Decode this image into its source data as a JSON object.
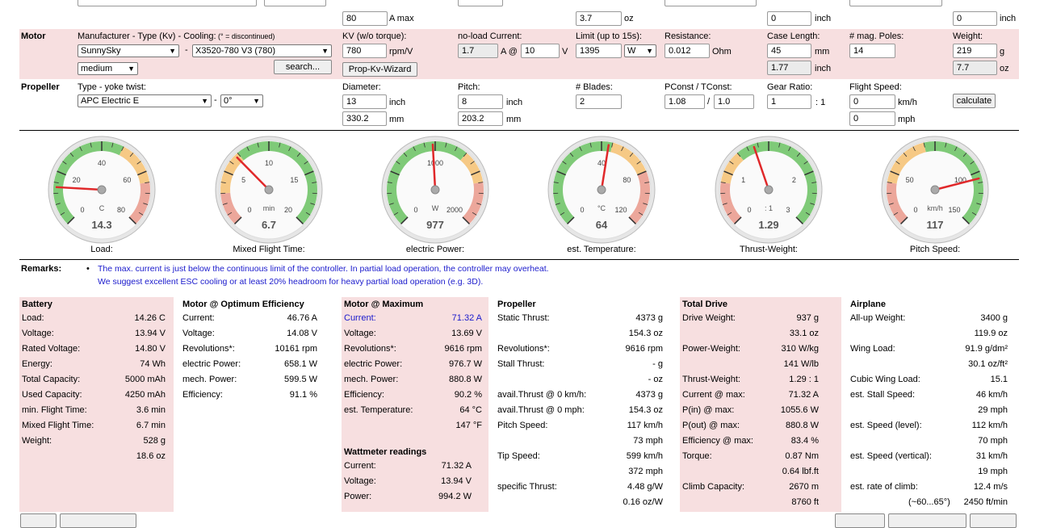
{
  "top_partial": {
    "amax_value": "80",
    "amax_unit": "A max",
    "oz_value": "3.7",
    "oz_unit": "oz",
    "inch1_value": "0",
    "inch1_unit": "inch",
    "inch2_value": "0",
    "inch2_unit": "inch"
  },
  "motor": {
    "section": "Motor",
    "mfr_label": "Manufacturer - Type (Kv) - Cooling:",
    "mfr_note": "(° = discontinued)",
    "manufacturer": "SunnySky",
    "dash": "-",
    "type": "X3520-780 V3 (780)",
    "cooling": "medium",
    "search_label": "search...",
    "kv_label": "KV (w/o torque):",
    "kv_value": "780",
    "kv_unit": "rpm/V",
    "propkv_label": "Prop-Kv-Wizard",
    "noload_label": "no-load Current:",
    "noload_a": "1.7",
    "noload_a_unit": "A @",
    "noload_v": "10",
    "noload_v_unit": "V",
    "limit_label": "Limit (up to 15s):",
    "limit_value": "1395",
    "limit_unit": "W",
    "res_label": "Resistance:",
    "res_value": "0.012",
    "res_unit": "Ohm",
    "case_label": "Case Length:",
    "case_mm": "45",
    "case_mm_unit": "mm",
    "case_inch": "1.77",
    "case_inch_unit": "inch",
    "poles_label": "# mag. Poles:",
    "poles_value": "14",
    "weight_label": "Weight:",
    "weight_g": "219",
    "weight_g_unit": "g",
    "weight_oz": "7.7",
    "weight_oz_unit": "oz"
  },
  "propeller_input": {
    "section": "Propeller",
    "type_label": "Type - yoke twist:",
    "type": "APC Electric E",
    "dash": "-",
    "twist": "0°",
    "dia_label": "Diameter:",
    "dia_inch": "13",
    "dia_inch_unit": "inch",
    "dia_mm": "330.2",
    "dia_mm_unit": "mm",
    "pitch_label": "Pitch:",
    "pitch_inch": "8",
    "pitch_inch_unit": "inch",
    "pitch_mm": "203.2",
    "pitch_mm_unit": "mm",
    "blades_label": "# Blades:",
    "blades_value": "2",
    "pconst_label": "PConst / TConst:",
    "pconst": "1.08",
    "slash": "/",
    "tconst": "1.0",
    "gear_label": "Gear Ratio:",
    "gear_value": "1",
    "gear_unit": ": 1",
    "speed_label": "Flight Speed:",
    "speed_kmh": "0",
    "speed_kmh_unit": "km/h",
    "speed_mph": "0",
    "speed_mph_unit": "mph",
    "calc_label": "calculate"
  },
  "gauges": [
    {
      "caption": "Load:",
      "value": "14.3",
      "unit": "C",
      "ticks": [
        "0",
        "20",
        "40",
        "60",
        "80"
      ],
      "min": 0,
      "max": 80,
      "reading": 14.3,
      "green_to": 0.6,
      "yellow_to": 0.8
    },
    {
      "caption": "Mixed Flight Time:",
      "value": "6.7",
      "unit": "min",
      "ticks": [
        "0",
        "5",
        "10",
        "15",
        "20"
      ],
      "min": 0,
      "max": 20,
      "reading": 6.7,
      "red_to": 0.15,
      "yellow_to": 0.35,
      "reverse": true
    },
    {
      "caption": "electric Power:",
      "value": "977",
      "unit": "W",
      "ticks": [
        "0",
        "",
        "1000",
        "",
        "2000"
      ],
      "min": 0,
      "max": 2000,
      "reading": 977,
      "green_to": 0.65,
      "yellow_to": 0.8
    },
    {
      "caption": "est. Temperature:",
      "value": "64",
      "unit": "°C",
      "ticks": [
        "0",
        "",
        "40",
        "80",
        "120"
      ],
      "min": 0,
      "max": 120,
      "reading": 64,
      "green_to": 0.55,
      "yellow_to": 0.75
    },
    {
      "caption": "Thrust-Weight:",
      "value": "1.29",
      "unit": ": 1",
      "ticks": [
        "0",
        "1",
        "",
        "2",
        "3"
      ],
      "min": 0,
      "max": 3,
      "reading": 1.29,
      "red_to": 0.2,
      "yellow_to": 0.35,
      "reverse": true
    },
    {
      "caption": "Pitch Speed:",
      "value": "117",
      "unit": "km/h",
      "ticks": [
        "0",
        "50",
        "",
        "100",
        "150"
      ],
      "min": 0,
      "max": 150,
      "reading": 117,
      "red_to": 0.2,
      "yellow_to": 0.45,
      "reverse": true
    }
  ],
  "remarks": {
    "label": "Remarks:",
    "bullet": "•",
    "line1": "The max. current is just below the continuous limit of the controller. In partial load operation, the controller may overheat.",
    "line2": "We suggest excellent ESC cooling or at least 20% headroom for heavy partial load operation (e.g. 3D)."
  },
  "battery": {
    "title": "Battery",
    "rows": [
      [
        "Load:",
        "14.26 C"
      ],
      [
        "Voltage:",
        "13.94 V"
      ],
      [
        "Rated Voltage:",
        "14.80 V"
      ],
      [
        "Energy:",
        "74 Wh"
      ],
      [
        "Total Capacity:",
        "5000 mAh"
      ],
      [
        "Used Capacity:",
        "4250 mAh"
      ],
      [
        "min. Flight Time:",
        "3.6 min"
      ],
      [
        "Mixed Flight Time:",
        "6.7 min"
      ],
      [
        "Weight:",
        "528 g"
      ],
      [
        "",
        "18.6 oz"
      ]
    ]
  },
  "motor_opt": {
    "title": "Motor @ Optimum Efficiency",
    "rows": [
      [
        "Current:",
        "46.76 A"
      ],
      [
        "Voltage:",
        "14.08 V"
      ],
      [
        "Revolutions*:",
        "10161 rpm"
      ],
      [
        "electric Power:",
        "658.1 W"
      ],
      [
        "mech. Power:",
        "599.5 W"
      ],
      [
        "Efficiency:",
        "91.1 %"
      ]
    ]
  },
  "motor_max": {
    "title": "Motor @ Maximum",
    "rows": [
      [
        "Current:",
        "71.32 A"
      ],
      [
        "Voltage:",
        "13.69 V"
      ],
      [
        "Revolutions*:",
        "9616 rpm"
      ],
      [
        "electric Power:",
        "976.7 W"
      ],
      [
        "mech. Power:",
        "880.8 W"
      ],
      [
        "Efficiency:",
        "90.2 %"
      ],
      [
        "est. Temperature:",
        "64 °C"
      ],
      [
        "",
        "147 °F"
      ]
    ],
    "watt_title": "Wattmeter readings",
    "watt_rows": [
      [
        "Current:",
        "71.32 A"
      ],
      [
        "Voltage:",
        "13.94 V"
      ],
      [
        "Power:",
        "994.2 W"
      ]
    ]
  },
  "propeller_out": {
    "title": "Propeller",
    "rows": [
      [
        "Static Thrust:",
        "4373 g"
      ],
      [
        "",
        "154.3 oz"
      ],
      [
        "Revolutions*:",
        "9616 rpm"
      ],
      [
        "Stall Thrust:",
        "- g"
      ],
      [
        "",
        "- oz"
      ],
      [
        "avail.Thrust @ 0 km/h:",
        "4373 g"
      ],
      [
        "avail.Thrust @ 0 mph:",
        "154.3 oz"
      ],
      [
        "Pitch Speed:",
        "117 km/h"
      ],
      [
        "",
        "73 mph"
      ],
      [
        "Tip Speed:",
        "599 km/h"
      ],
      [
        "",
        "372 mph"
      ],
      [
        "specific Thrust:",
        "4.48 g/W"
      ],
      [
        "",
        "0.16 oz/W"
      ]
    ]
  },
  "total_drive": {
    "title": "Total Drive",
    "rows": [
      [
        "Drive Weight:",
        "937 g"
      ],
      [
        "",
        "33.1 oz"
      ],
      [
        "Power-Weight:",
        "310 W/kg"
      ],
      [
        "",
        "141 W/lb"
      ],
      [
        "Thrust-Weight:",
        "1.29 : 1"
      ],
      [
        "Current @ max:",
        "71.32 A"
      ],
      [
        "P(in) @ max:",
        "1055.6 W"
      ],
      [
        "P(out) @ max:",
        "880.8 W"
      ],
      [
        "Efficiency @ max:",
        "83.4 %"
      ],
      [
        "Torque:",
        "0.87 Nm"
      ],
      [
        "",
        "0.64 lbf.ft"
      ],
      [
        "Climb Capacity:",
        "2670 m"
      ],
      [
        "",
        "8760 ft"
      ]
    ]
  },
  "airplane": {
    "title": "Airplane",
    "rows": [
      [
        "All-up Weight:",
        "3400 g"
      ],
      [
        "",
        "119.9 oz"
      ],
      [
        "Wing Load:",
        "91.9 g/dm²"
      ],
      [
        "",
        "30.1 oz/ft²"
      ],
      [
        "Cubic Wing Load:",
        "15.1"
      ],
      [
        "est. Stall Speed:",
        "46 km/h"
      ],
      [
        "",
        "29 mph"
      ],
      [
        "est. Speed (level):",
        "112 km/h"
      ],
      [
        "",
        "70 mph"
      ],
      [
        "est. Speed (vertical):",
        "31 km/h"
      ],
      [
        "",
        "19 mph"
      ],
      [
        "est. rate of climb:",
        "12.4 m/s"
      ],
      [
        "(~60...65°)",
        "2450 ft/min"
      ]
    ]
  }
}
